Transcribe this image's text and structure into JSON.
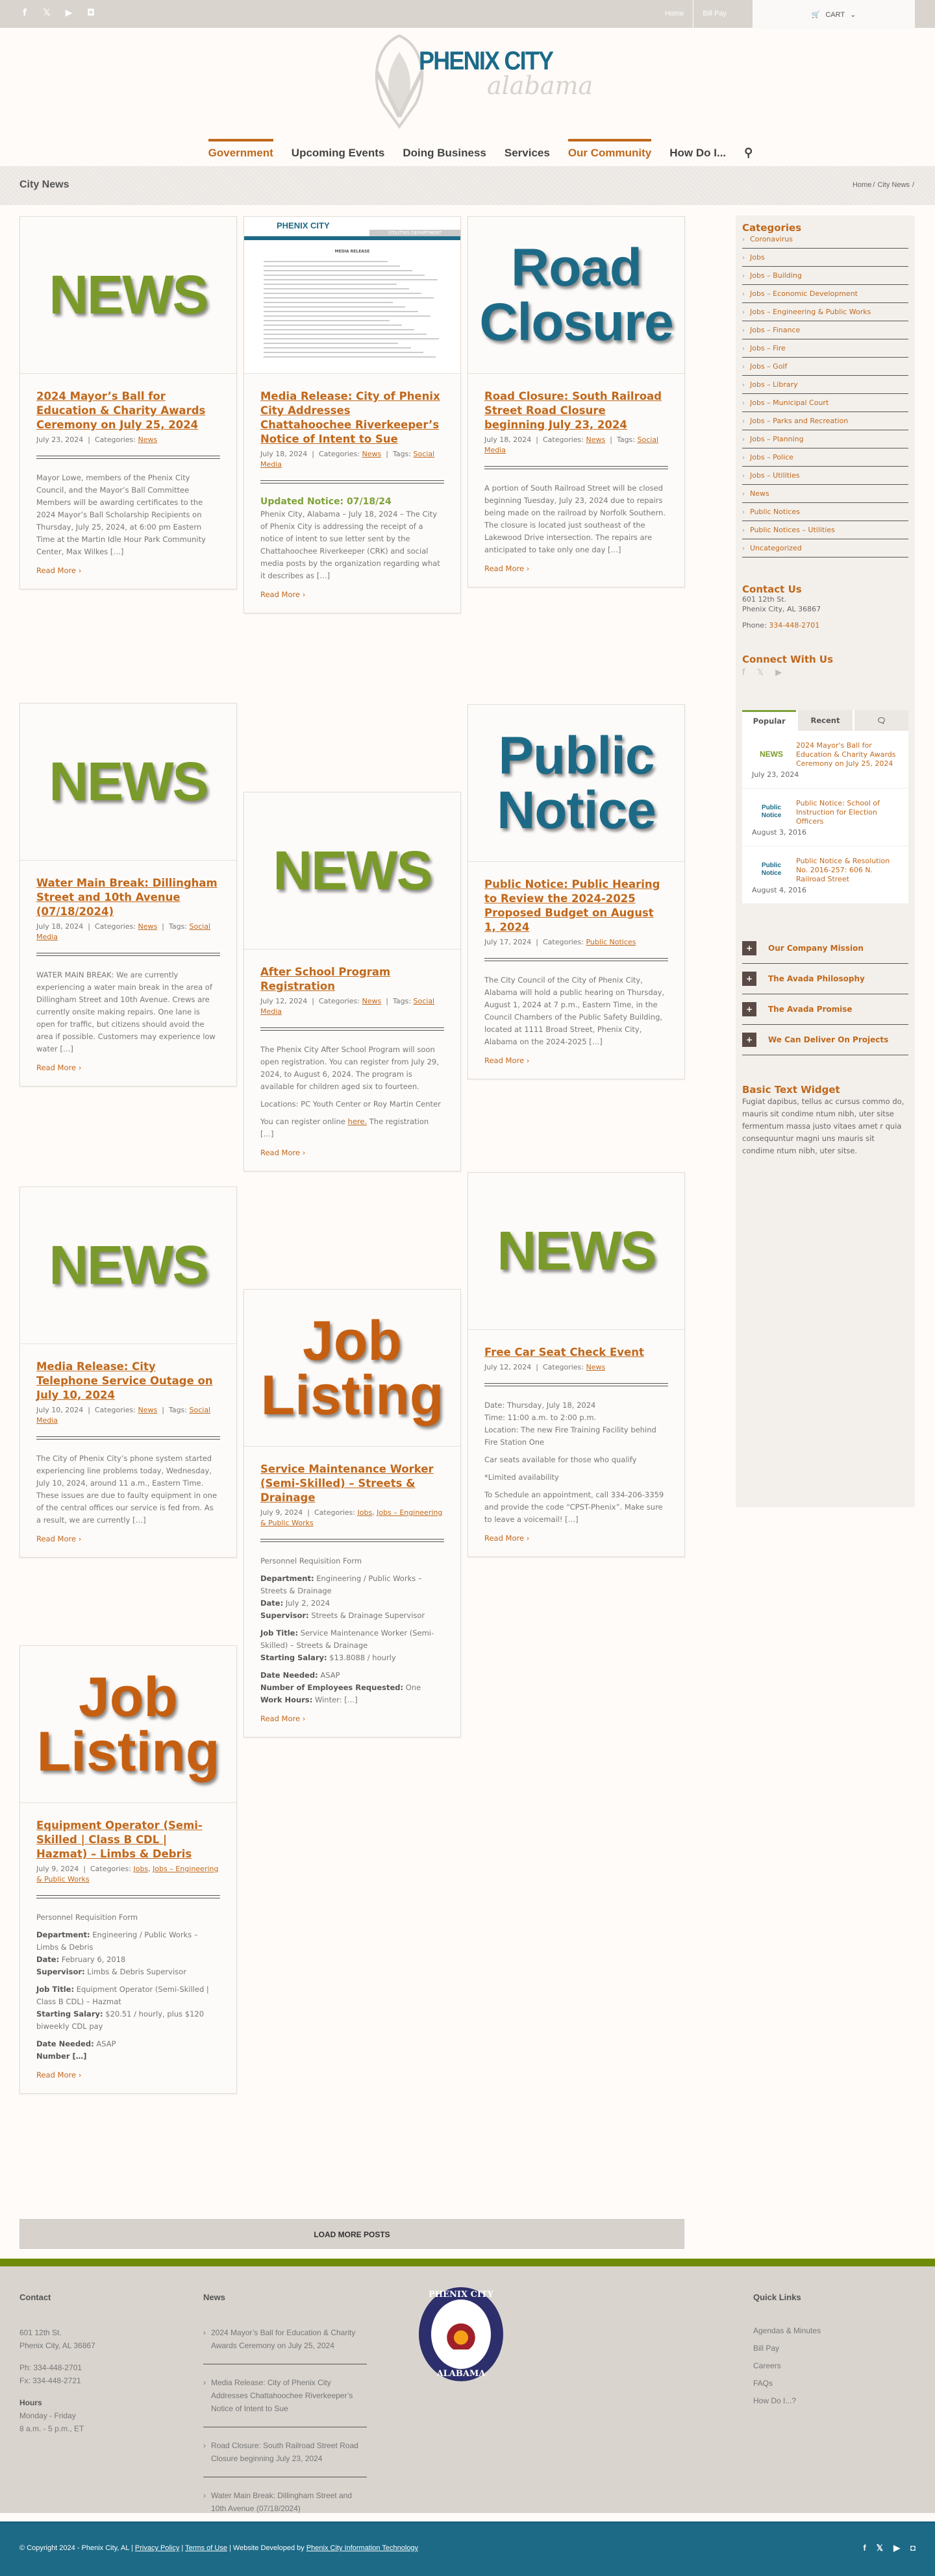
{
  "colors": {
    "accent": "#c0681c",
    "brand_blue": "#1d6a87",
    "green": "#7ea13a",
    "footer_bar": "#6f8c08"
  },
  "topbar": {
    "social_icons": [
      "facebook-icon",
      "x-icon",
      "youtube-icon",
      "podcast-icon"
    ],
    "links": [
      "Home",
      "Bill Pay"
    ],
    "cart_label": "CART"
  },
  "logo": {
    "line1": "PHENIX CITY",
    "line2": "alabama"
  },
  "nav": {
    "items": [
      {
        "label": "Government",
        "active": true
      },
      {
        "label": "Upcoming Events",
        "active": false
      },
      {
        "label": "Doing Business",
        "active": false
      },
      {
        "label": "Services",
        "active": false
      },
      {
        "label": "Our Community",
        "active": true
      },
      {
        "label": "How Do I...",
        "active": false
      }
    ]
  },
  "page": {
    "title": "City News",
    "breadcrumb": [
      "Home",
      "City News"
    ]
  },
  "posts": [
    {
      "image": "NEWS",
      "title": "2024 Mayor’s Ball for Education & Charity Awards Ceremony on July 25, 2024",
      "date": "July 23, 2024",
      "categories": [
        "News"
      ],
      "tags": [],
      "excerpt": [
        "Mayor Lowe, members of the Phenix City Council, and the Mayor’s Ball Committee Members will be awarding certificates to the 2024 Mayor’s Ball Scholarship Recipients on Thursday, July 25, 2024, at 6:00 pm Eastern Time at the Martin Idle Hour Park Community Center, Max Wilkes […]"
      ],
      "read_more": "Read More"
    },
    {
      "image": "MEDIA RELEASE",
      "title": "Media Release: City of Phenix City Addresses Chattahoochee Riverkeeper’s Notice of Intent to Sue",
      "date": "July 18, 2024",
      "categories": [
        "News"
      ],
      "tags": [
        "Social Media"
      ],
      "updated": "Updated Notice: 07/18/24",
      "excerpt": [
        "Phenix City, Alabama – July 18, 2024 – The City of Phenix City is addressing the receipt of a notice of intent to sue letter sent by the Chattahoochee Riverkeeper (CRK) and social media posts by the organization regarding what it describes as […]"
      ],
      "read_more": "Read More"
    },
    {
      "image": "Road Closure",
      "title": "Road Closure: South Railroad Street Road Closure beginning July 23, 2024",
      "date": "July 18, 2024",
      "categories": [
        "News"
      ],
      "tags": [
        "Social Media"
      ],
      "excerpt": [
        "A portion of South Railroad Street will be closed beginning Tuesday, July 23, 2024 due to repairs being made on the railroad by Norfolk Southern. The closure is located just southeast of the Lakewood Drive intersection. The repairs are anticipated to take only one day […]"
      ],
      "read_more": "Read More"
    },
    {
      "image": "NEWS",
      "title": "Water Main Break: Dillingham Street and 10th Avenue (07/18/2024)",
      "date": "July 18, 2024",
      "categories": [
        "News"
      ],
      "tags": [
        "Social Media"
      ],
      "excerpt": [
        "WATER MAIN BREAK:  We are currently experiencing a water main break in the area of Dillingham Street and 10th Avenue. Crews are currently onsite making repairs. One lane is open for traffic, but citizens should avoid the area if possible. Customers may experience low water […]"
      ],
      "read_more": "Read More"
    },
    {
      "image": "NEWS",
      "title": "After School Program Registration",
      "date": "July 12, 2024",
      "categories": [
        "News"
      ],
      "tags": [
        "Social Media"
      ],
      "excerpt": [
        "The Phenix City After School Program will soon open registration. You can register from July 29, 2024, to August 6, 2024. The program is available for children aged six to fourteen.",
        "Locations: PC Youth Center or Roy Martin Center"
      ],
      "excerpt_link_pre": "You can register online ",
      "excerpt_link": "here.",
      "excerpt_link_post": " The registration […]",
      "read_more": "Read More"
    },
    {
      "image": "Public Notice",
      "title": "Public Notice: Public Hearing to Review the 2024-2025 Proposed Budget on August 1, 2024",
      "date": "July 17, 2024",
      "categories": [
        "Public Notices"
      ],
      "tags": [],
      "excerpt": [
        "The City Council of the City of Phenix City, Alabama will hold a public hearing on Thursday, August 1, 2024 at 7 p.m., Eastern Time, in the Council Chambers of the Public Safety Building, located at 1111 Broad Street, Phenix City, Alabama on the 2024-2025 […]"
      ],
      "read_more": "Read More"
    },
    {
      "image": "NEWS",
      "title": "Media Release: City Telephone Service Outage on July 10, 2024",
      "date": "July 10, 2024",
      "categories": [
        "News"
      ],
      "tags": [
        "Social Media"
      ],
      "excerpt": [
        "The City of Phenix City’s phone system started experiencing line problems today, Wednesday, July 10, 2024, around 11 a.m., Eastern Time. These issues are due to faulty equipment in one of the central offices our service is fed from. As a result, we are currently […]"
      ],
      "read_more": "Read More"
    },
    {
      "image": "Job Listing",
      "title": "Service Maintenance Worker (Semi-Skilled) – Streets & Drainage",
      "date": "July 9, 2024",
      "categories": [
        "Jobs",
        "Jobs – Engineering & Public Works"
      ],
      "tags": [],
      "form_title": "Personnel Requisition Form",
      "fields": [
        [
          {
            "k": "Department:",
            "v": " Engineering / Public Works – Streets & Drainage"
          },
          {
            "k": "Date:",
            "v": " July 2, 2024"
          },
          {
            "k": "Supervisor:",
            "v": " Streets & Drainage Supervisor"
          }
        ],
        [
          {
            "k": "Job Title:",
            "v": " Service Maintenance Worker (Semi-Skilled) – Streets & Drainage"
          },
          {
            "k": "Starting Salary:",
            "v": " $13.8088 / hourly"
          }
        ],
        [
          {
            "k": "Date Needed:",
            "v": " ASAP"
          },
          {
            "k": "Number of Employees Requested:",
            "v": " One"
          },
          {
            "k": "Work Hours:",
            "v": " Winter: […]"
          }
        ]
      ],
      "read_more": "Read More"
    },
    {
      "image": "NEWS",
      "title": "Free Car Seat Check Event",
      "date": "July 12, 2024",
      "categories": [
        "News"
      ],
      "tags": [],
      "excerpt": [
        "Date: Thursday, July 18, 2024\nTime: 11:00 a.m. to 2:00 p.m.\nLocation: The new Fire Training Facility behind Fire Station One",
        "Car seats available for those who qualify",
        "*Limited availability",
        "To Schedule an appointment, call 334-206-3359 and provide the code “CPST-Phenix”. Make sure to leave a voicemail! […]"
      ],
      "read_more": "Read More"
    },
    {
      "image": "Job Listing",
      "title": "Equipment Operator (Semi-Skilled | Class B CDL | Hazmat) – Limbs & Debris",
      "date": "July 9, 2024",
      "categories": [
        "Jobs",
        "Jobs – Engineering & Public Works"
      ],
      "tags": [],
      "form_title": "Personnel Requisition Form",
      "fields": [
        [
          {
            "k": "Department:",
            "v": " Engineering / Public Works – Limbs & Debris"
          },
          {
            "k": "Date:",
            "v": " February 6, 2018"
          },
          {
            "k": "Supervisor:",
            "v": " Limbs & Debris Supervisor"
          }
        ],
        [
          {
            "k": "Job Title:",
            "v": " Equipment Operator (Semi-Skilled | Class B CDL) – Hazmat"
          },
          {
            "k": "Starting Salary:",
            "v": " $20.51 / hourly, plus $120 biweekly CDL pay"
          }
        ],
        [
          {
            "k": "Date Needed:",
            "v": " ASAP"
          },
          {
            "k": "Number […]",
            "v": ""
          }
        ]
      ],
      "read_more": "Read More"
    }
  ],
  "meta_labels": {
    "categories": "Categories:",
    "tags": "Tags:",
    "sep": "|"
  },
  "load_more": "LOAD MORE POSTS",
  "sidebar": {
    "categories_title": "Categories",
    "categories": [
      "Coronavirus",
      "Jobs",
      "Jobs – Building",
      "Jobs – Economic Development",
      "Jobs – Engineering & Public Works",
      "Jobs – Finance",
      "Jobs – Fire",
      "Jobs – Golf",
      "Jobs – Library",
      "Jobs – Municipal Court",
      "Jobs – Parks and Recreation",
      "Jobs – Planning",
      "Jobs – Police",
      "Jobs – Utilities",
      "News",
      "Public Notices",
      "Public Notices – Utilities",
      "Uncategorized"
    ],
    "contact_title": "Contact Us",
    "address1": "601 12th St.",
    "address2": "Phenix City, AL 36867",
    "phone_label": "Phone: ",
    "phone": "334-448-2701",
    "connect_title": "Connect With Us",
    "connect_icons": [
      "facebook-icon",
      "x-icon",
      "youtube-icon"
    ],
    "tabs": [
      "Popular",
      "Recent",
      "comments"
    ],
    "popular": [
      {
        "thumb": "NEWS",
        "title": "2024 Mayor's Ball for Education & Charity Awards Ceremony on July 25, 2024",
        "date": "July 23, 2024"
      },
      {
        "thumb": "Public Notice",
        "title": "Public Notice: School of Instruction for Election Officers",
        "date": "August 3, 2016"
      },
      {
        "thumb": "Public Notice",
        "title": "Public Notice & Resolution No. 2016-257: 606 N. Railroad Street",
        "date": "August 4, 2016"
      }
    ],
    "accordion": [
      "Our Company Mission",
      "The Avada Philosophy",
      "The Avada Promise",
      "We Can Deliver On Projects"
    ],
    "text_widget_title": "Basic Text Widget",
    "text_widget_body": "Fugiat dapibus, tellus ac cursus commo do, mauris sit condime ntum nibh, uter sitse fermentum massa justo vitaes amet r quia consequuntur magni uns mauris sit condime ntum nibh, uter sitse."
  },
  "footer": {
    "contact_title": "Contact",
    "address1": "601 12th St.",
    "address2": "Phenix City, AL 36867",
    "phone": "Ph: 334-448-2701",
    "fax": "Fx: 334-448-2721",
    "hours_title": "Hours",
    "hours1": "Monday - Friday",
    "hours2": "8 a.m. - 5 p.m., ET",
    "news_title": "News",
    "news": [
      "2024 Mayor’s Ball for Education & Charity Awards Ceremony on July 25, 2024",
      "Media Release: City of Phenix City Addresses Chattahoochee Riverkeeper’s Notice of Intent to Sue",
      "Road Closure: South Railroad Street Road Closure beginning July 23, 2024",
      "Water Main Break: Dillingham Street and 10th Avenue (07/18/2024)"
    ],
    "seal_top": "PHENIX CITY",
    "seal_bottom": "ALABAMA",
    "quick_title": "Quick Links",
    "quick_links": [
      "Agendas & Minutes",
      "Bill Pay",
      "Careers",
      "FAQs",
      "How Do I...?"
    ],
    "copyright": "© Copyright 2024 - Phenix City, AL | ",
    "privacy": "Privacy Policy",
    "terms": "Terms of Use",
    "developed": " | Website Developed by ",
    "developer": "Phenix City Information Technology",
    "social_icons": [
      "facebook-icon",
      "x-icon",
      "youtube-icon",
      "podcast-icon"
    ]
  }
}
